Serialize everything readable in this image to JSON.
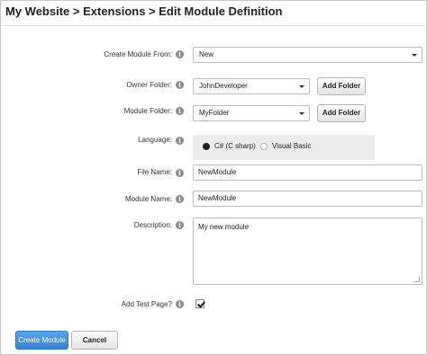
{
  "header": {
    "title": "My Website > Extensions > Edit Module Definition"
  },
  "form": {
    "create_from": {
      "label": "Create Module From:",
      "value": "New"
    },
    "owner_folder": {
      "label": "Owner Folder:",
      "value": "JohnDeveloper",
      "add_label": "Add Folder"
    },
    "module_folder": {
      "label": "Module Folder:",
      "value": "MyFolder",
      "add_label": "Add Folder"
    },
    "language": {
      "label": "Language:",
      "options": [
        "C# (C sharp)",
        "Visual Basic"
      ],
      "selected": "C# (C sharp)"
    },
    "file_name": {
      "label": "File Name:",
      "value": "NewModule"
    },
    "module_name": {
      "label": "Module Name:",
      "value": "NewModule"
    },
    "description": {
      "label": "Description:",
      "value": "My new module"
    },
    "add_test_page": {
      "label": "Add Test Page?",
      "checked": true
    }
  },
  "actions": {
    "create_label": "Create Module",
    "cancel_label": "Cancel"
  },
  "icons": {
    "info": "info-icon",
    "dropdown": "chevron-down-icon"
  },
  "colors": {
    "primary_button": "#3d8bd8",
    "radio_panel": "#ececec"
  }
}
